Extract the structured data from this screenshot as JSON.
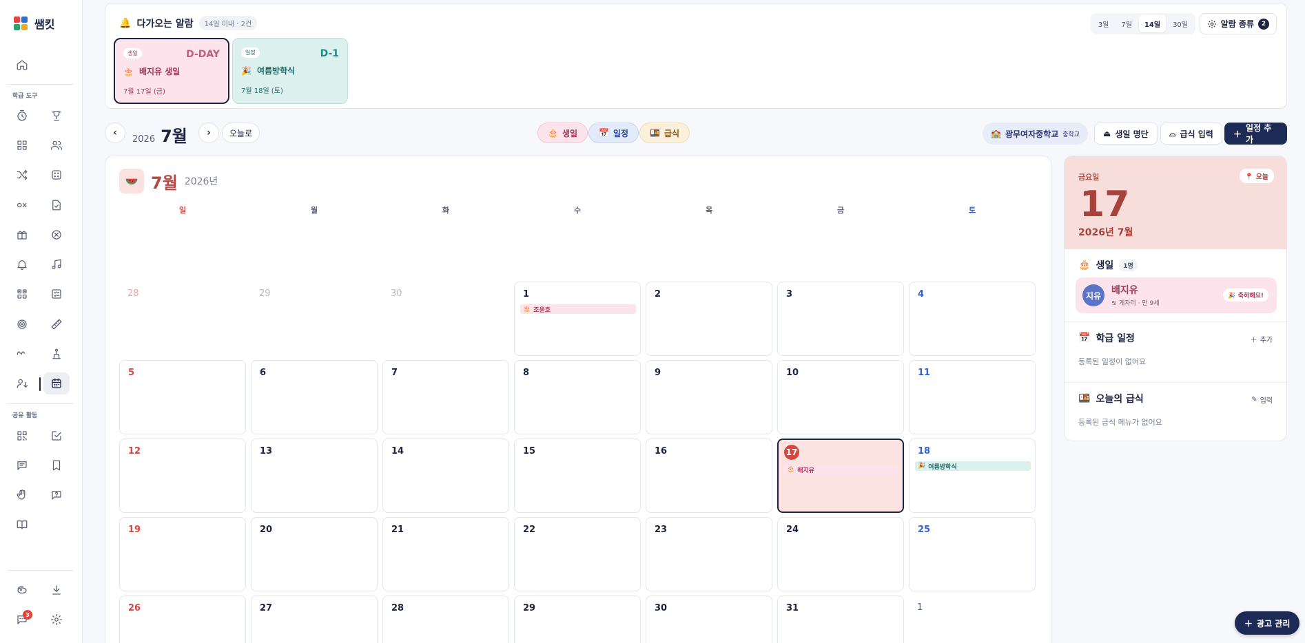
{
  "app": {
    "name": "쌤킷"
  },
  "sidebar": {
    "section_class_tools": "학급 도구",
    "section_shared": "공유 활동",
    "chat_badge": "3"
  },
  "alarms": {
    "title": "다가오는 알람",
    "range_chip": "14일 이내 · 2건",
    "ranges": [
      "3일",
      "7일",
      "14일",
      "30일"
    ],
    "selected_range": "14일",
    "kind_label": "알람 종류",
    "kind_count": "2",
    "cards": [
      {
        "tag": "생일",
        "dday": "D-DAY",
        "name": "배지유 생일",
        "date": "7월 17일 (금)"
      },
      {
        "tag": "일정",
        "dday": "D-1",
        "name": "여름방학식",
        "date": "7월 18일 (토)"
      }
    ]
  },
  "toolbar": {
    "prev": "‹",
    "next": "›",
    "year": "2026",
    "month": "7월",
    "today": "오늘로",
    "filters": [
      "생일",
      "일정",
      "급식"
    ],
    "school": "광무여자중학교",
    "school_level": "중학교",
    "birthday_list": "생일 명단",
    "meal_input": "급식 입력",
    "add_event": "일정 추가"
  },
  "calendar": {
    "month": "7월",
    "year": "2026년",
    "weekdays": [
      "일",
      "월",
      "화",
      "수",
      "목",
      "금",
      "토"
    ],
    "weeks": [
      [
        {
          "d": "28",
          "o": true
        },
        {
          "d": "29",
          "o": true
        },
        {
          "d": "30",
          "o": true
        },
        {
          "d": "1",
          "e": "조윤호",
          "t": "b"
        },
        {
          "d": "2"
        },
        {
          "d": "3"
        },
        {
          "d": "4"
        }
      ],
      [
        {
          "d": "5"
        },
        {
          "d": "6"
        },
        {
          "d": "7"
        },
        {
          "d": "8"
        },
        {
          "d": "9"
        },
        {
          "d": "10"
        },
        {
          "d": "11"
        }
      ],
      [
        {
          "d": "12"
        },
        {
          "d": "13"
        },
        {
          "d": "14"
        },
        {
          "d": "15"
        },
        {
          "d": "16"
        },
        {
          "d": "17",
          "today": true,
          "e": "배지유",
          "t": "b"
        },
        {
          "d": "18",
          "e": "여름방학식",
          "t": "s"
        }
      ],
      [
        {
          "d": "19"
        },
        {
          "d": "20"
        },
        {
          "d": "21"
        },
        {
          "d": "22"
        },
        {
          "d": "23"
        },
        {
          "d": "24"
        },
        {
          "d": "25"
        }
      ],
      [
        {
          "d": "26"
        },
        {
          "d": "27"
        },
        {
          "d": "28"
        },
        {
          "d": "29"
        },
        {
          "d": "30"
        },
        {
          "d": "31"
        },
        {
          "d": "1",
          "o": true
        }
      ]
    ]
  },
  "today_panel": {
    "weekday": "금요일",
    "day": "17",
    "year_month": "2026년 7월",
    "today_pill": "오늘",
    "birthday_title": "생일",
    "birthday_count": "1명",
    "birthday_avatar": "지유",
    "birthday_name": "배지유",
    "birthday_meta": "게자리 · 만 9세",
    "congrats": "축하해요!",
    "schedule_title": "학급 일정",
    "schedule_add": "추가",
    "schedule_empty": "등록된 일정이 없어요",
    "meal_title": "오늘의 급식",
    "meal_input": "입력",
    "meal_empty": "등록된 급식 메뉴가 없어요"
  },
  "ad_button": "광고 관리",
  "colors": {
    "accent_navy": "#1d2a55",
    "birthday_pink": "#fce3ec",
    "schedule_teal": "#dcf1ee",
    "today_red": "#d9463f"
  }
}
